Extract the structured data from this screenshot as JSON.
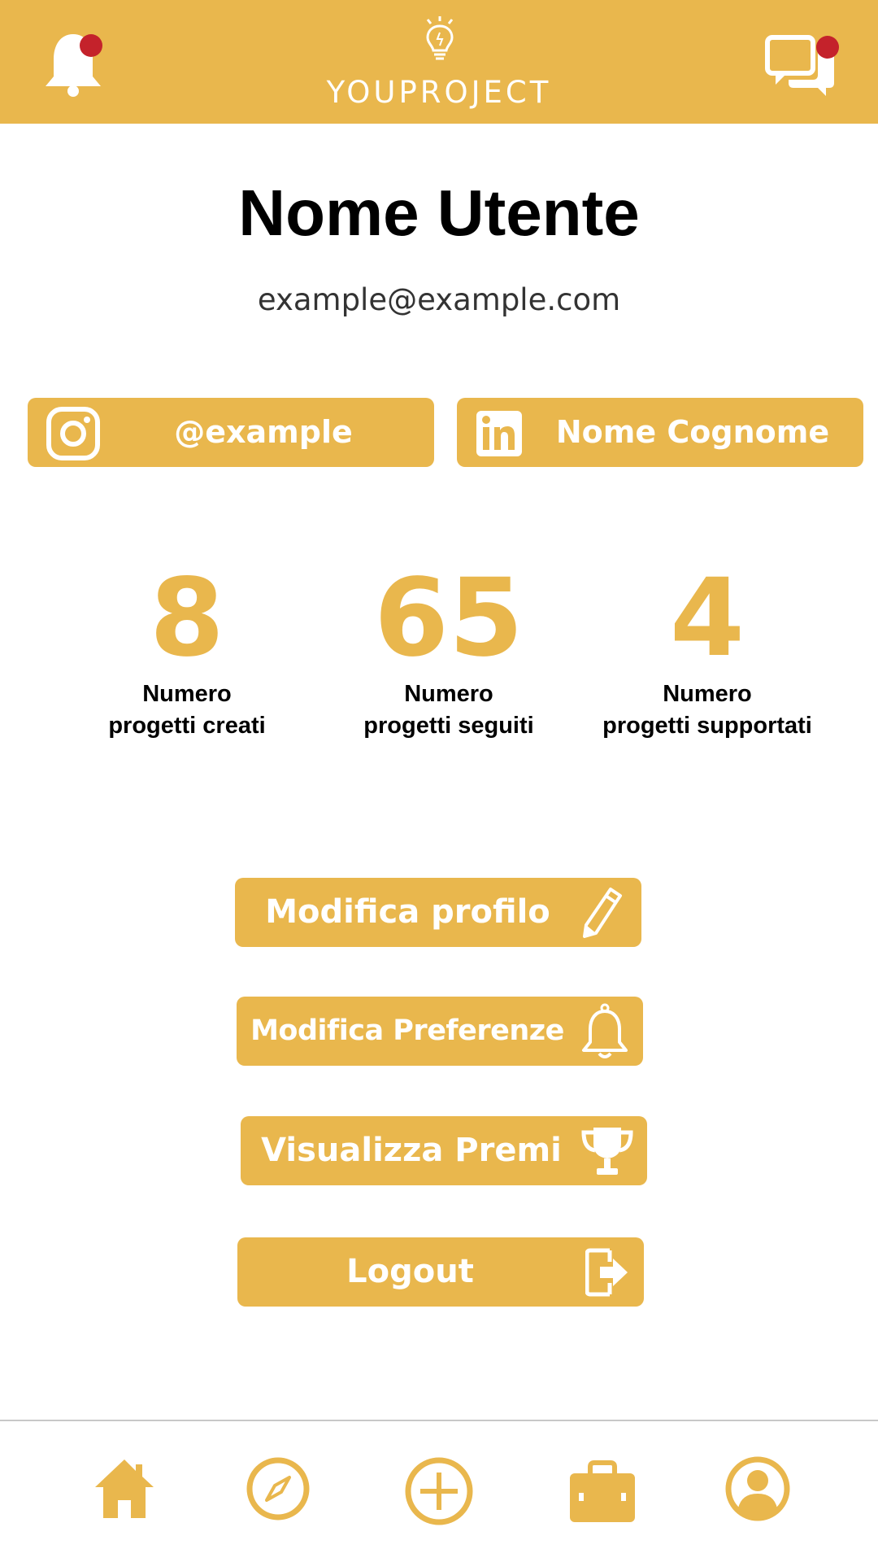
{
  "header": {
    "app_name": "YOUPROJECT",
    "bell_icon": "bell-icon",
    "chat_icon": "chat-icon",
    "logo_icon": "lightbulb-icon",
    "brand_color": "#e9b74d",
    "notification_color": "#c4222b"
  },
  "profile": {
    "name": "Nome Utente",
    "email": "example@example.com"
  },
  "social": {
    "instagram_label": "@example",
    "linkedin_label": "Nome Cognome"
  },
  "stats": [
    {
      "value": "8",
      "line1": "Numero",
      "line2": "progetti creati"
    },
    {
      "value": "65",
      "line1": "Numero",
      "line2": "progetti seguiti"
    },
    {
      "value": "4",
      "line1": "Numero",
      "line2": "progetti supportati"
    }
  ],
  "actions": {
    "edit_profile": "Modifica profilo",
    "edit_preferences": "Modifica Preferenze",
    "view_awards": "Visualizza Premi",
    "logout": "Logout"
  },
  "bottom_nav": {
    "items": [
      "home-icon",
      "compass-icon",
      "add-icon",
      "briefcase-icon",
      "user-icon"
    ]
  }
}
